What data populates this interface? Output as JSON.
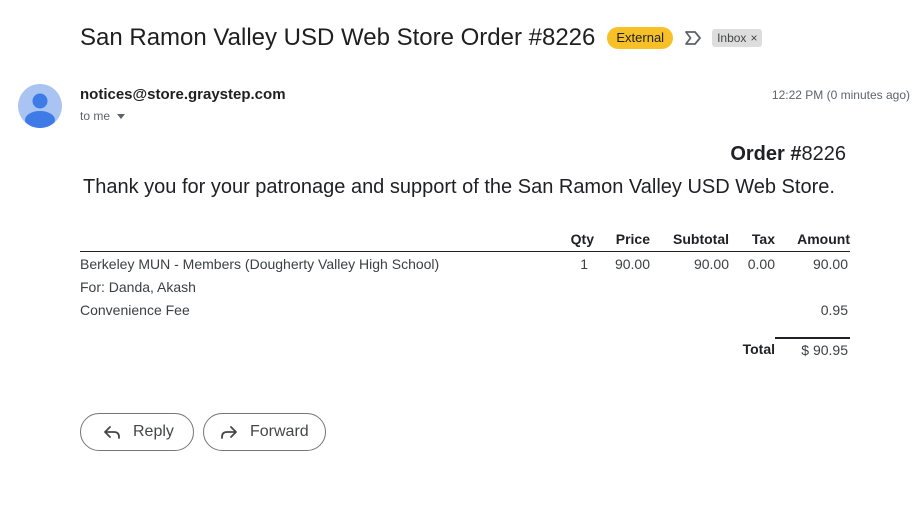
{
  "email": {
    "subject": "San Ramon Valley USD Web Store Order #8226",
    "badge_external": "External",
    "label_inbox": "Inbox",
    "label_remove": "×",
    "sender": "notices@store.graystep.com",
    "to_line": "to me",
    "timestamp": "12:22 PM (0 minutes ago)"
  },
  "order": {
    "heading_bold": "Order #",
    "heading_number": "8226",
    "thanks": "Thank you for your patronage and support of the San Ramon Valley USD Web Store.",
    "columns": [
      "",
      "Qty",
      "Price",
      "Subtotal",
      "Tax",
      "Amount"
    ],
    "item": {
      "description": "Berkeley MUN - Members (Dougherty Valley High School)",
      "qty": "1",
      "price": "90.00",
      "subtotal": "90.00",
      "tax": "0.00",
      "amount": "90.00",
      "for": "For: Danda, Akash"
    },
    "fee": {
      "description": "Convenience Fee",
      "amount": "0.95"
    },
    "total_label": "Total",
    "total_amount": "$ 90.95"
  },
  "actions": {
    "reply": "Reply",
    "forward": "Forward"
  },
  "icons": {
    "important": "important-marker-icon",
    "avatar": "person-icon",
    "reply": "reply-arrow-icon",
    "forward": "forward-arrow-icon",
    "caret": "caret-down-icon"
  },
  "colors": {
    "external_badge": "#f6c026",
    "inbox_label": "#dddddd",
    "avatar_bg": "#a9c3f2",
    "avatar_fg": "#3f7be6"
  }
}
